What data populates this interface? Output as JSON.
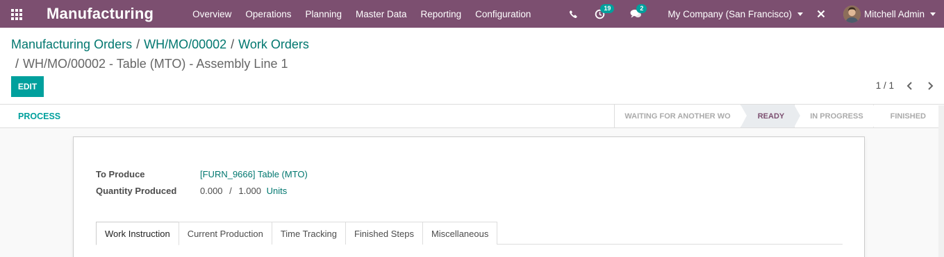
{
  "navbar": {
    "app_name": "Manufacturing",
    "menu": [
      "Overview",
      "Operations",
      "Planning",
      "Master Data",
      "Reporting",
      "Configuration"
    ],
    "activity_count": "19",
    "messages_count": "2",
    "company": "My Company (San Francisco)",
    "user": "Mitchell Admin"
  },
  "breadcrumb": {
    "items": [
      "Manufacturing Orders",
      "WH/MO/00002",
      "Work Orders"
    ],
    "current": "WH/MO/00002 - Table (MTO) - Assembly Line 1",
    "separator": "/"
  },
  "actions": {
    "edit_label": "EDIT"
  },
  "pager": {
    "value": "1 / 1"
  },
  "statusbar": {
    "process_label": "PROCESS",
    "stages": [
      "WAITING FOR ANOTHER WO",
      "READY",
      "IN PROGRESS",
      "FINISHED"
    ],
    "active_stage": "READY"
  },
  "form": {
    "to_produce_label": "To Produce",
    "to_produce_value": "[FURN_9666] Table (MTO)",
    "qty_label": "Quantity Produced",
    "qty_produced": "0.000",
    "qty_sep": "/",
    "qty_total": "1.000",
    "qty_uom": "Units"
  },
  "tabs": [
    "Work Instruction",
    "Current Production",
    "Time Tracking",
    "Finished Steps",
    "Miscellaneous"
  ],
  "colors": {
    "navbar": "#7c4f70",
    "primary": "#00a09d",
    "link": "#00776f"
  }
}
